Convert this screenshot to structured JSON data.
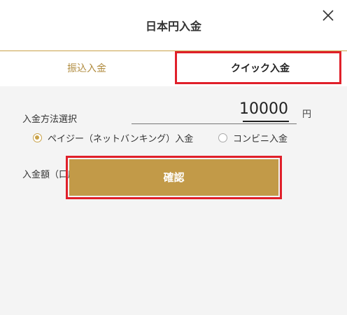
{
  "dialog": {
    "title": "日本円入金"
  },
  "tabs": [
    {
      "label": "振込入金",
      "active": false
    },
    {
      "label": "クイック入金",
      "active": true
    }
  ],
  "deposit_method": {
    "label": "入金方法選択",
    "options": [
      {
        "label": "ペイジー（ネットバンキング）入金",
        "selected": true
      },
      {
        "label": "コンビニ入金",
        "selected": false
      }
    ]
  },
  "amount": {
    "label": "入金額（口座反映額）",
    "value": "10000",
    "unit": "円"
  },
  "confirm_button": {
    "label": "確認"
  },
  "colors": {
    "accent": "#c29a48",
    "highlight": "#e0202a",
    "background": "#f4f4f4"
  }
}
